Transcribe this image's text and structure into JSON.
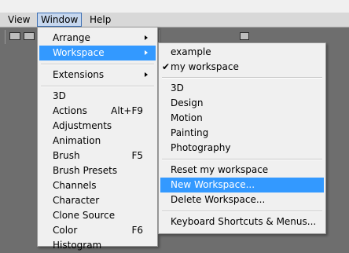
{
  "menubar": {
    "items": [
      {
        "label": "View"
      },
      {
        "label": "Window"
      },
      {
        "label": "Help"
      }
    ]
  },
  "window_menu": {
    "items": [
      {
        "label": "Arrange",
        "has_submenu": true
      },
      {
        "label": "Workspace",
        "has_submenu": true
      },
      {
        "label": "Extensions",
        "has_submenu": true
      },
      {
        "label": "3D"
      },
      {
        "label": "Actions",
        "shortcut": "Alt+F9"
      },
      {
        "label": "Adjustments"
      },
      {
        "label": "Animation"
      },
      {
        "label": "Brush",
        "shortcut": "F5"
      },
      {
        "label": "Brush Presets"
      },
      {
        "label": "Channels"
      },
      {
        "label": "Character"
      },
      {
        "label": "Clone Source"
      },
      {
        "label": "Color",
        "shortcut": "F6"
      },
      {
        "label": "Histogram"
      }
    ]
  },
  "workspace_menu": {
    "items": [
      {
        "label": "example"
      },
      {
        "label": "my workspace",
        "checked": true
      },
      {
        "label": "3D"
      },
      {
        "label": "Design"
      },
      {
        "label": "Motion"
      },
      {
        "label": "Painting"
      },
      {
        "label": "Photography"
      },
      {
        "label": "Reset my workspace"
      },
      {
        "label": "New Workspace..."
      },
      {
        "label": "Delete Workspace..."
      },
      {
        "label": "Keyboard Shortcuts & Menus..."
      }
    ],
    "check_glyph": "✔"
  },
  "colors": {
    "highlight": "#3399ff",
    "menu_bg": "#f0f0f0",
    "workspace_bg": "#6e6e6e"
  }
}
